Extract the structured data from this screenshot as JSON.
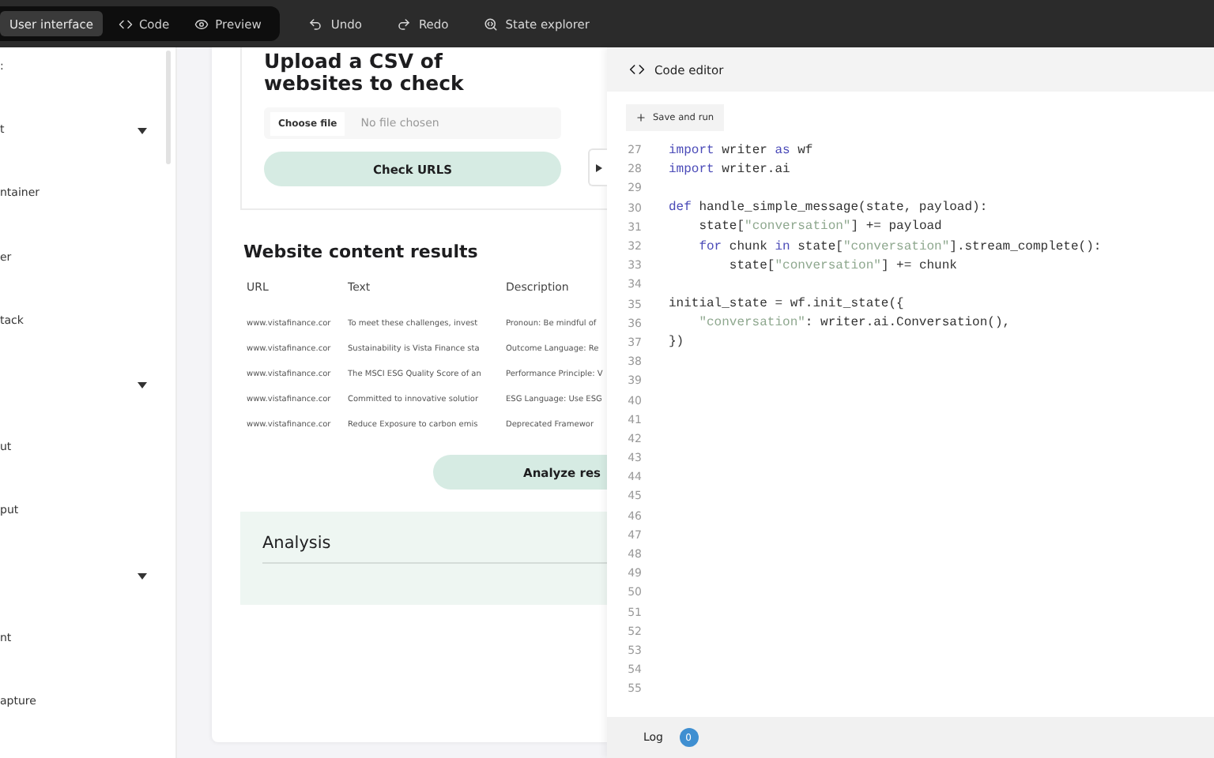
{
  "toolbar": {
    "modes": [
      {
        "label": "User interface",
        "selected": true
      },
      {
        "label": "Code",
        "selected": false
      },
      {
        "label": "Preview",
        "selected": false
      }
    ],
    "actions": [
      {
        "label": "Undo"
      },
      {
        "label": "Redo"
      },
      {
        "label": "State explorer"
      }
    ]
  },
  "sidebar": {
    "items": [
      {
        "label": ":",
        "expandable": false
      },
      {
        "label": "t",
        "expandable": true
      },
      {
        "label": "ntainer",
        "expandable": false
      },
      {
        "label": "er",
        "expandable": false
      },
      {
        "label": "tack",
        "expandable": false
      },
      {
        "expandable": true
      },
      {
        "label": "ut",
        "expandable": false
      },
      {
        "label": "put",
        "expandable": false
      },
      {
        "expandable": true
      },
      {
        "label": "nt",
        "expandable": false
      },
      {
        "label": "apture",
        "expandable": false
      }
    ]
  },
  "upload": {
    "title": "Upload a CSV of websites to check",
    "file_button": "Choose file",
    "file_status": "No file chosen",
    "submit": "Check URLS"
  },
  "results": {
    "title": "Website content results",
    "columns": [
      "URL",
      "Text",
      "Description"
    ],
    "rows": [
      [
        "www.vistafinance.cor",
        "To meet these challenges, invest",
        "Pronoun: Be mindful of"
      ],
      [
        "www.vistafinance.cor",
        "Sustainability is Vista Finance sta",
        "Outcome Language: Re"
      ],
      [
        "www.vistafinance.cor",
        "The MSCI ESG Quality Score of an",
        "Performance Principle: V"
      ],
      [
        "www.vistafinance.cor",
        "Committed to innovative solutior",
        "ESG Language: Use ESG"
      ],
      [
        "www.vistafinance.cor",
        "Reduce Exposure to carbon emis",
        "Deprecated Framewor"
      ]
    ],
    "analyze_button": "Analyze res"
  },
  "analysis": {
    "title": "Analysis"
  },
  "editor": {
    "title": "Code editor",
    "save_button": "Save and run",
    "lines": [
      {
        "number": "27",
        "tokens": [
          {
            "kind": "keyword",
            "text": "import"
          },
          {
            "kind": "plain",
            "text": " writer "
          },
          {
            "kind": "keyword",
            "text": "as"
          },
          {
            "kind": "plain",
            "text": " wf"
          }
        ]
      },
      {
        "number": "28",
        "tokens": [
          {
            "kind": "keyword",
            "text": "import"
          },
          {
            "kind": "plain",
            "text": " writer.ai"
          }
        ]
      },
      {
        "number": "29"
      },
      {
        "number": "30",
        "tokens": [
          {
            "kind": "keyword",
            "text": "def"
          },
          {
            "kind": "plain",
            "text": " handle_simple_message(state, payload):"
          }
        ]
      },
      {
        "number": "31",
        "tokens": [
          {
            "kind": "plain",
            "text": "    state["
          },
          {
            "kind": "string",
            "text": "\"conversation\""
          },
          {
            "kind": "plain",
            "text": "] += payload"
          }
        ]
      },
      {
        "number": "32",
        "tokens": [
          {
            "kind": "keyword",
            "text": "    for"
          },
          {
            "kind": "plain",
            "text": " chunk "
          },
          {
            "kind": "keyword",
            "text": "in"
          },
          {
            "kind": "plain",
            "text": " state["
          },
          {
            "kind": "string",
            "text": "\"conversation\""
          },
          {
            "kind": "plain",
            "text": "].stream_complete():"
          }
        ]
      },
      {
        "number": "33",
        "tokens": [
          {
            "kind": "plain",
            "text": "        state["
          },
          {
            "kind": "string",
            "text": "\"conversation\""
          },
          {
            "kind": "plain",
            "text": "] += chunk"
          }
        ]
      },
      {
        "number": "34"
      },
      {
        "number": "35",
        "tokens": [
          {
            "kind": "plain",
            "text": "initial_state = wf.init_state({"
          }
        ]
      },
      {
        "number": "36",
        "tokens": [
          {
            "kind": "string",
            "text": "    \"conversation\""
          },
          {
            "kind": "plain",
            "text": ": writer.ai.Conversation(),"
          }
        ]
      },
      {
        "number": "37",
        "tokens": [
          {
            "kind": "plain",
            "text": "})"
          }
        ]
      },
      {
        "number": "38"
      },
      {
        "number": "39"
      },
      {
        "number": "40"
      },
      {
        "number": "41"
      },
      {
        "number": "42"
      },
      {
        "number": "43"
      },
      {
        "number": "44"
      },
      {
        "number": "45"
      },
      {
        "number": "46"
      },
      {
        "number": "47"
      },
      {
        "number": "48"
      },
      {
        "number": "49"
      },
      {
        "number": "50"
      },
      {
        "number": "51"
      },
      {
        "number": "52"
      },
      {
        "number": "53"
      },
      {
        "number": "54"
      },
      {
        "number": "55"
      }
    ],
    "log_label": "Log",
    "log_count": "0"
  }
}
